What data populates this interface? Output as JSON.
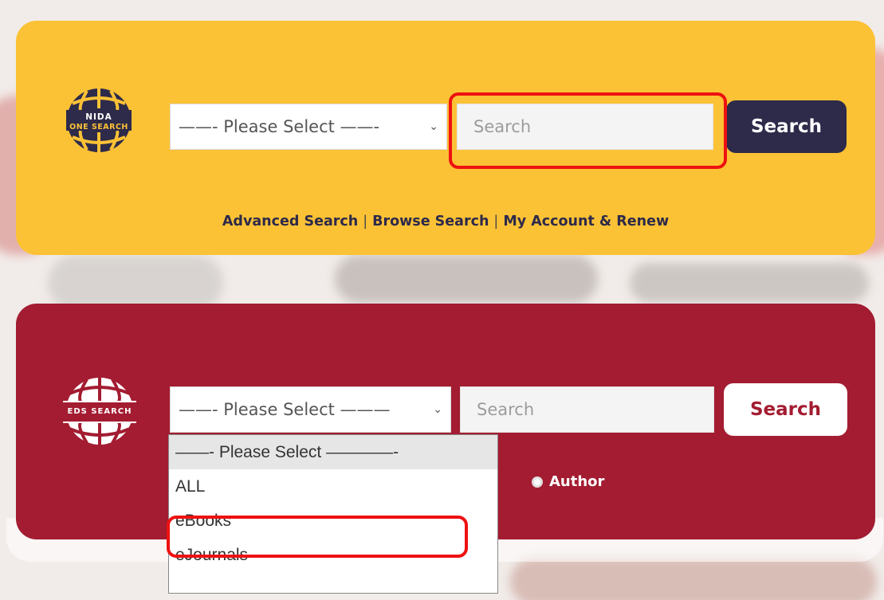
{
  "one_search": {
    "logo_line1": "NIDA",
    "logo_line2": "ONE SEARCH",
    "select_value": "——- Please Select ——-",
    "search_placeholder": "Search",
    "search_button": "Search",
    "links": [
      "Advanced Search",
      "Browse Search",
      "My Account & Renew"
    ],
    "separator": "|",
    "bg_color": "#fcc235",
    "button_color": "#2d2a4a"
  },
  "eds_search": {
    "logo_text": "EDS SEARCH",
    "select_value": "——- Please Select ———",
    "search_placeholder": "Search",
    "search_button": "Search",
    "radio_author": "Author",
    "bg_color": "#a31c31",
    "dropdown_options": [
      "——- Please Select ————-",
      "ALL",
      "eBooks",
      "eJournals"
    ],
    "dropdown_selected": "——- Please Select ————-"
  },
  "icons": {
    "chevron": "⌄"
  }
}
